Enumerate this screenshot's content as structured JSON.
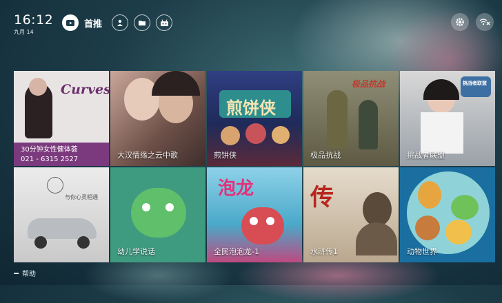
{
  "status": {
    "time": "16:12",
    "date": "九月 14"
  },
  "nav": {
    "items": [
      {
        "label": "首推",
        "icon": "tv-icon",
        "active": true
      },
      {
        "label": "",
        "icon": "person-icon",
        "active": false
      },
      {
        "label": "",
        "icon": "folder-icon",
        "active": false
      },
      {
        "label": "",
        "icon": "robot-icon",
        "active": false
      }
    ]
  },
  "topright": {
    "icons": [
      "gear-icon",
      "wifi-off-icon"
    ]
  },
  "tiles": [
    {
      "caption": "",
      "art_text": "Curves",
      "art_sub": "30分钟女性健体荟",
      "art_phone": "021 - 6315 2527"
    },
    {
      "caption": "大汉情缘之云中歌",
      "art_text": ""
    },
    {
      "caption": "煎饼侠",
      "art_text": "煎饼侠"
    },
    {
      "caption": "极品抗战",
      "art_text": "极品抗战"
    },
    {
      "caption": "挑战者联盟",
      "art_text": "挑战者联盟"
    },
    {
      "caption": "",
      "art_text": "与你心灵相通"
    },
    {
      "caption": "幼儿学说话",
      "art_text": ""
    },
    {
      "caption": "全民泡泡龙-1",
      "art_text": "泡龙"
    },
    {
      "caption": "水浒传1",
      "art_text": "传"
    },
    {
      "caption": "动物世界",
      "art_text": ""
    }
  ],
  "footer": {
    "help_label": "帮助"
  },
  "colors": {
    "bg": "#1d3d49",
    "accent": "#ffffff"
  }
}
